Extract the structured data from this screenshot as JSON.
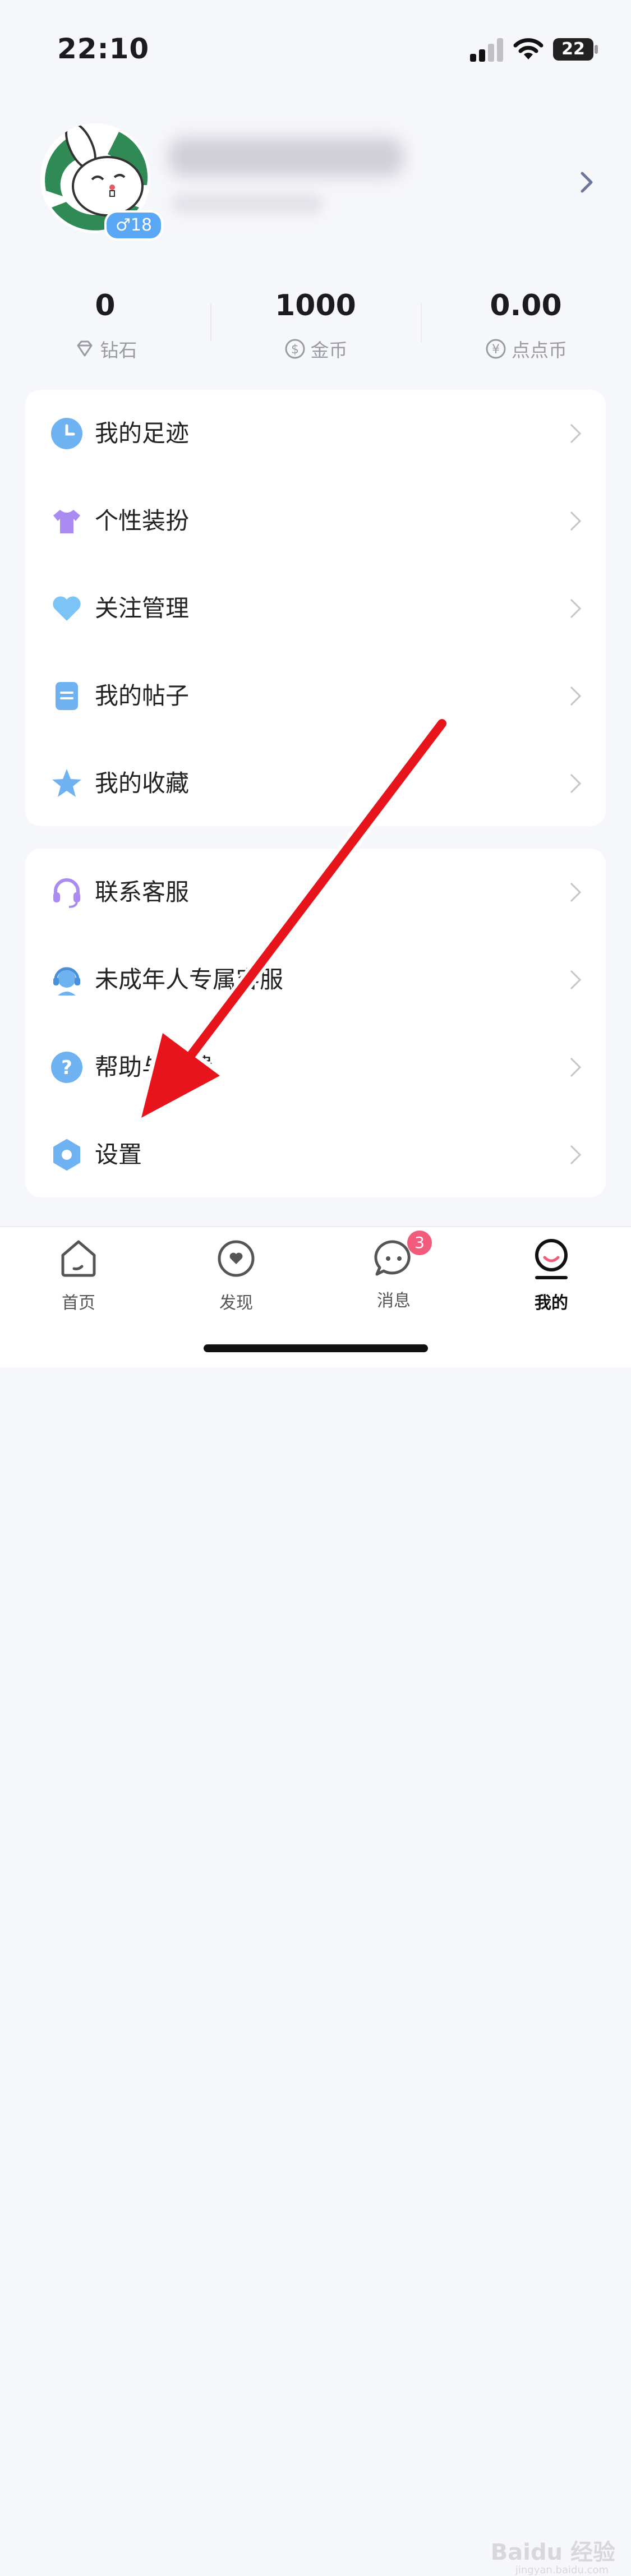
{
  "status": {
    "time": "22:10",
    "battery": "22"
  },
  "profile": {
    "gender_age": "♂18"
  },
  "stats": [
    {
      "value": "0",
      "label": "钻石"
    },
    {
      "value": "1000",
      "label": "金币"
    },
    {
      "value": "0.00",
      "label": "点点币"
    }
  ],
  "menu1": [
    {
      "label": "我的足迹",
      "icon": "clock-icon"
    },
    {
      "label": "个性装扮",
      "icon": "tshirt-icon"
    },
    {
      "label": "关注管理",
      "icon": "heart-icon"
    },
    {
      "label": "我的帖子",
      "icon": "document-icon"
    },
    {
      "label": "我的收藏",
      "icon": "star-icon"
    }
  ],
  "menu2": [
    {
      "label": "联系客服",
      "icon": "headset-icon"
    },
    {
      "label": "未成年人专属客服",
      "icon": "agent-icon"
    },
    {
      "label": "帮助与反馈",
      "icon": "question-icon"
    },
    {
      "label": "设置",
      "icon": "gear-icon"
    }
  ],
  "tabs": [
    {
      "label": "首页",
      "icon": "home-icon"
    },
    {
      "label": "发现",
      "icon": "discover-icon"
    },
    {
      "label": "消息",
      "icon": "message-icon",
      "badge": "3"
    },
    {
      "label": "我的",
      "icon": "profile-icon",
      "active": true
    }
  ],
  "watermark": {
    "brand": "Baidu 经验",
    "url": "jingyan.baidu.com"
  },
  "colors": {
    "accent_blue": "#5aa7f5",
    "badge_pink": "#f25b7c",
    "arrow_red": "#e8141b"
  }
}
